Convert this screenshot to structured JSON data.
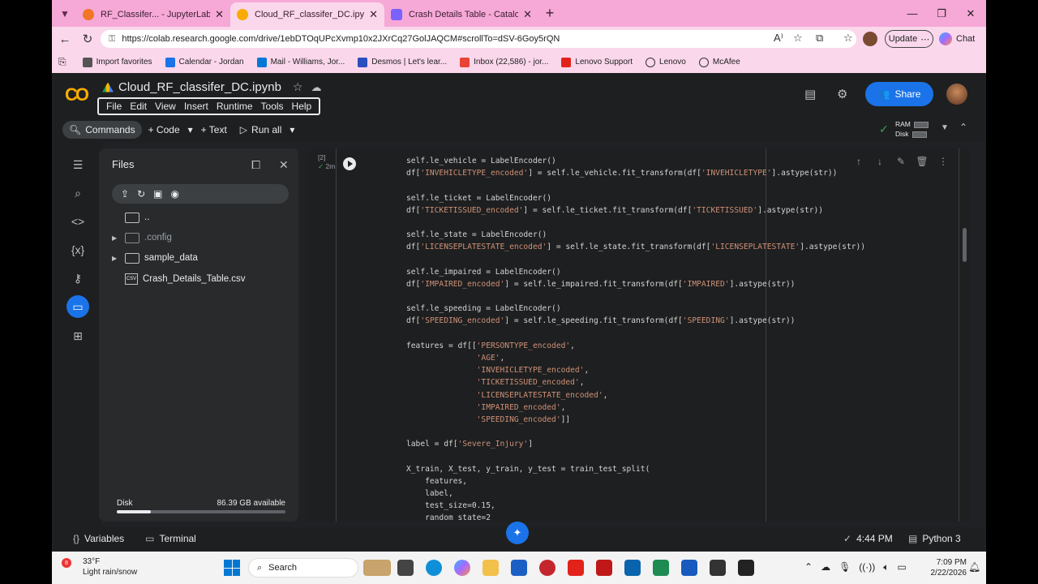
{
  "browser": {
    "tabs": [
      {
        "label": "RF_Classifer... - JupyterLab",
        "color": "#f37626",
        "active": false
      },
      {
        "label": "Cloud_RF_classifer_DC.ipynb - Cola",
        "color": "#f9ab00",
        "active": true
      },
      {
        "label": "Crash Details Table - Catalog",
        "color": "#7b61ff",
        "active": false
      }
    ],
    "url": "https://colab.research.google.com/drive/1ebDTOqUPcXvmp10x2JXrCq27GolJAQCM#scrollTo=dSV-6Goy5rQN",
    "update_label": "Update",
    "chat_label": "Chat",
    "bookmarks": [
      {
        "label": "Import favorites",
        "color": "#555555"
      },
      {
        "label": "Calendar - Jordan",
        "color": "#1a73e8"
      },
      {
        "label": "Mail - Williams, Jor...",
        "color": "#0078d4"
      },
      {
        "label": "Desmos | Let's lear...",
        "color": "#2a4fbf"
      },
      {
        "label": "Inbox (22,586) - jor...",
        "color": "#ea4335"
      },
      {
        "label": "Lenovo Support",
        "color": "#e2231a"
      },
      {
        "label": "Lenovo",
        "color": "#333333"
      },
      {
        "label": "McAfee",
        "color": "#333333"
      }
    ]
  },
  "colab": {
    "logo": "CO",
    "notebook_title": "Cloud_RF_classifer_DC.ipynb",
    "menu": [
      "File",
      "Edit",
      "View",
      "Insert",
      "Runtime",
      "Tools",
      "Help"
    ],
    "share_label": "Share",
    "toolbar": {
      "commands": "Commands",
      "code": "+ Code",
      "text": "+ Text",
      "run_all": "Run all",
      "ram": "RAM",
      "disk": "Disk"
    }
  },
  "files": {
    "title": "Files",
    "items": [
      {
        "name": "..",
        "type": "folder",
        "expandable": false
      },
      {
        "name": ".config",
        "type": "folder",
        "expandable": true
      },
      {
        "name": "sample_data",
        "type": "folder",
        "expandable": true
      },
      {
        "name": "Crash_Details_Table.csv",
        "type": "csv",
        "expandable": false
      }
    ],
    "disk_label": "Disk",
    "disk_available": "86.39 GB available",
    "disk_fraction": 0.2
  },
  "cell": {
    "exec_count": "[2]",
    "duration": "2m",
    "code_lines": [
      "self.le_vehicle = LabelEncoder()",
      "df['INVEHICLETYPE_encoded'] = self.le_vehicle.fit_transform(df['INVEHICLETYPE'].astype(str))",
      "",
      "self.le_ticket = LabelEncoder()",
      "df['TICKETISSUED_encoded'] = self.le_ticket.fit_transform(df['TICKETISSUED'].astype(str))",
      "",
      "self.le_state = LabelEncoder()",
      "df['LICENSEPLATESTATE_encoded'] = self.le_state.fit_transform(df['LICENSEPLATESTATE'].astype(str))",
      "",
      "self.le_impaired = LabelEncoder()",
      "df['IMPAIRED_encoded'] = self.le_impaired.fit_transform(df['IMPAIRED'].astype(str))",
      "",
      "self.le_speeding = LabelEncoder()",
      "df['SPEEDING_encoded'] = self.le_speeding.fit_transform(df['SPEEDING'].astype(str))",
      "",
      "features = df[['PERSONTYPE_encoded',",
      "               'AGE',",
      "               'INVEHICLETYPE_encoded',",
      "               'TICKETISSUED_encoded',",
      "               'LICENSEPLATESTATE_encoded',",
      "               'IMPAIRED_encoded',",
      "               'SPEEDING_encoded']]",
      "",
      "label = df['Severe_Injury']",
      "",
      "X_train, X_test, y_train, y_test = train_test_split(",
      "    features,",
      "    label,",
      "    test_size=0.15,",
      "    random_state=2"
    ]
  },
  "statusbar": {
    "variables": "Variables",
    "terminal": "Terminal",
    "time": "4:44 PM",
    "kernel": "Python 3"
  },
  "taskbar": {
    "temp": "33°F",
    "weather": "Light rain/snow",
    "weather_badge": "8",
    "search": "Search",
    "clock_time": "7:09 PM",
    "clock_date": "2/22/2026"
  }
}
